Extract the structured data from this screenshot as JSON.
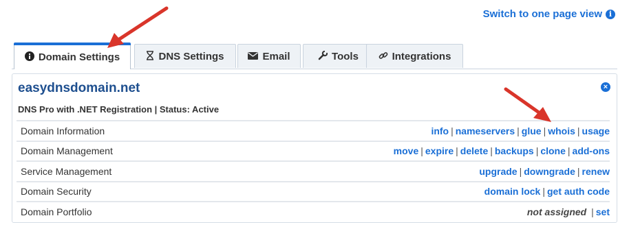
{
  "header": {
    "switch_view_label": "Switch to one page view",
    "switch_icon": "info-circle-icon"
  },
  "tabs": [
    {
      "label": "Domain Settings",
      "icon": "info-circle-icon",
      "active": true
    },
    {
      "label": "DNS Settings",
      "icon": "hourglass-icon",
      "active": false
    },
    {
      "label": "Email",
      "icon": "envelope-icon",
      "active": false
    },
    {
      "label": "Tools",
      "icon": "wrench-icon",
      "active": false
    },
    {
      "label": "Integrations",
      "icon": "link-icon",
      "active": false
    }
  ],
  "panel": {
    "domain": "easydnsdomain.net",
    "plan_status": "DNS Pro with .NET Registration | Status: Active",
    "close_icon": "close-circle-icon",
    "rows": [
      {
        "label": "Domain Information",
        "actions": [
          "info",
          "nameservers",
          "glue",
          "whois",
          "usage"
        ]
      },
      {
        "label": "Domain Management",
        "actions": [
          "move",
          "expire",
          "delete",
          "backups",
          "clone",
          "add-ons"
        ]
      },
      {
        "label": "Service Management",
        "actions": [
          "upgrade",
          "downgrade",
          "renew"
        ]
      },
      {
        "label": "Domain Security",
        "actions": [
          "domain lock",
          "get auth code"
        ]
      },
      {
        "label": "Domain Portfolio",
        "status_text": "not assigned",
        "actions": [
          "set"
        ]
      }
    ]
  },
  "colors": {
    "link": "#1a6fd6",
    "domain_title": "#1e4f8f",
    "arrow": "#d9352a",
    "tab_bg": "#eef2f6"
  }
}
